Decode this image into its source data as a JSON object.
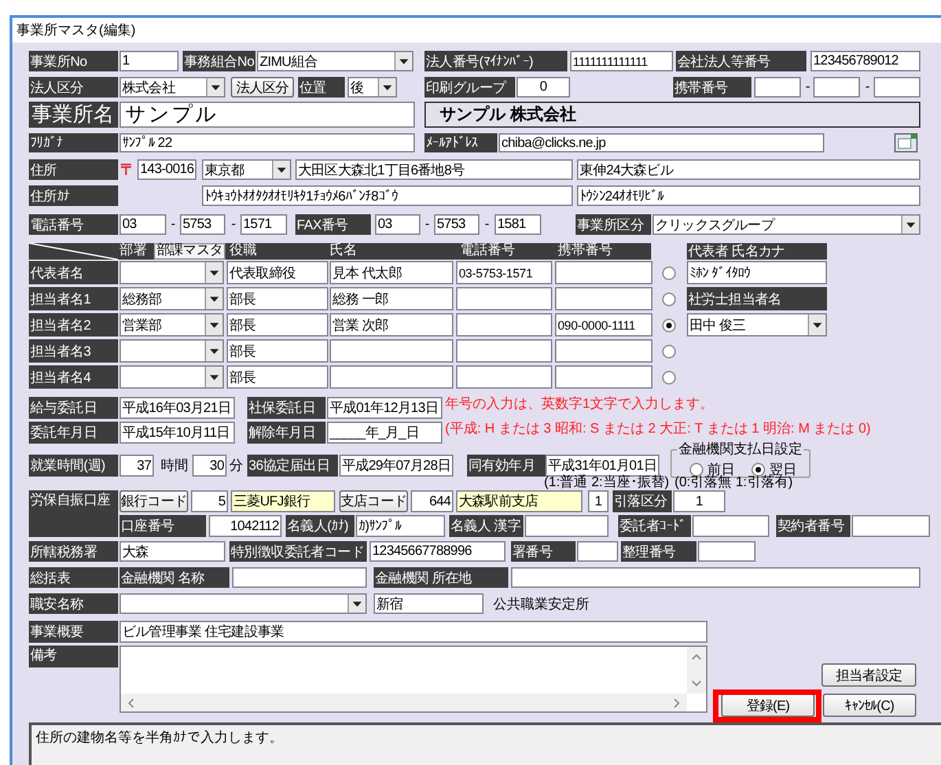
{
  "window": {
    "title": "事業所マスタ(編集)"
  },
  "header_rows": [
    {
      "items": [
        {
          "kind": "label",
          "text": "事業所No"
        },
        {
          "kind": "input",
          "value": "1"
        },
        {
          "kind": "label",
          "text": "事務組合No"
        },
        {
          "kind": "select",
          "value": "ZIMU組合"
        },
        {
          "kind": "label",
          "text": "法人番号(ﾏｲﾅﾝﾊﾞｰ)"
        },
        {
          "kind": "input",
          "value": "1111111111111"
        },
        {
          "kind": "label",
          "text": "会社法人等番号"
        },
        {
          "kind": "input",
          "value": "123456789012"
        }
      ]
    },
    {
      "items": [
        {
          "kind": "label",
          "text": "法人区分"
        },
        {
          "kind": "select",
          "value": "株式会社"
        },
        {
          "kind": "button",
          "label": "法人区分"
        },
        {
          "kind": "label",
          "text": "位置"
        },
        {
          "kind": "select",
          "value": "後"
        },
        {
          "kind": "label",
          "text": "印刷グループ"
        },
        {
          "kind": "input",
          "value": "0"
        },
        {
          "kind": "label",
          "text": "携帯番号"
        },
        {
          "kind": "input"
        },
        {
          "kind": "text",
          "text": "-"
        },
        {
          "kind": "input"
        },
        {
          "kind": "text",
          "text": "-"
        },
        {
          "kind": "input"
        }
      ]
    },
    {
      "items": [
        {
          "kind": "label-large",
          "text": "事業所名"
        },
        {
          "kind": "input-large",
          "value": "サンプル"
        },
        {
          "kind": "banner",
          "text": "サンプル 株式会社"
        }
      ]
    },
    {
      "items": [
        {
          "kind": "label",
          "text": "ﾌﾘｶﾞﾅ"
        },
        {
          "kind": "input",
          "value": "ｻﾝﾌﾟﾙ 22"
        },
        {
          "kind": "label",
          "text": "ﾒｰﾙｱﾄﾞﾚｽ"
        },
        {
          "kind": "input",
          "value": "chiba@clicks.ne.jp"
        },
        {
          "kind": "icon"
        }
      ]
    },
    {
      "items": [
        {
          "kind": "label",
          "text": "住所"
        },
        {
          "kind": "postal",
          "text": "〒"
        },
        {
          "kind": "input",
          "value": "143-0016"
        },
        {
          "kind": "select",
          "value": "東京都"
        },
        {
          "kind": "input",
          "value": "大田区大森北1丁目6番地8号"
        },
        {
          "kind": "input",
          "value": "東伸24大森ビル"
        }
      ]
    },
    {
      "items": [
        {
          "kind": "label",
          "text": "住所ｶﾅ"
        },
        {
          "kind": "input",
          "value": "ﾄｳｷｮｳﾄｵｵﾀｸｵｵﾓﾘｷﾀ1ﾁｮｳﾒ6ﾊﾞﾝﾁ8ｺﾞｳ"
        },
        {
          "kind": "input",
          "value": "ﾄｳｼﾝ24ｵｵﾓﾘﾋﾞﾙ"
        }
      ]
    },
    {
      "items": [
        {
          "kind": "label",
          "text": "電話番号"
        },
        {
          "kind": "input",
          "value": "03"
        },
        {
          "kind": "text",
          "text": "-"
        },
        {
          "kind": "input",
          "value": "5753"
        },
        {
          "kind": "text",
          "text": "-"
        },
        {
          "kind": "input",
          "value": "1571"
        },
        {
          "kind": "label",
          "text": "FAX番号"
        },
        {
          "kind": "input",
          "value": "03"
        },
        {
          "kind": "text",
          "text": "-"
        },
        {
          "kind": "input",
          "value": "5753"
        },
        {
          "kind": "text",
          "text": "-"
        },
        {
          "kind": "input",
          "value": "1581"
        },
        {
          "kind": "label",
          "text": "事業所区分"
        },
        {
          "kind": "select",
          "value": "クリックスグループ"
        }
      ]
    }
  ],
  "contacts": {
    "headers": [
      "部署",
      "役職",
      "氏名",
      "電話番号",
      "携帯番号"
    ],
    "master_button": "部課マスタ",
    "kana_label": "代表者 氏名カナ",
    "kana_value": "ﾐﾎﾝ ﾀﾞｲﾀﾛｳ",
    "consultant_label": "社労士担当者名",
    "consultant": "田中 俊三",
    "rows": [
      {
        "label": "代表者名",
        "title": "代表取締役",
        "name": "見本 代太郎",
        "phone": "03-5753-1571",
        "selected": false
      },
      {
        "label": "担当者名1",
        "department": "総務部",
        "title": "部長",
        "name": "総務 一郎",
        "selected": false
      },
      {
        "label": "担当者名2",
        "department": "営業部",
        "title": "部長",
        "name": "営業 次郎",
        "mobile": "090-0000-1111",
        "selected": true
      },
      {
        "label": "担当者名3",
        "title": "部長",
        "selected": false
      },
      {
        "label": "担当者名4",
        "title": "部長",
        "selected": false
      }
    ]
  },
  "date_rows": [
    {
      "items": [
        {
          "kind": "label",
          "text": "給与委託日"
        },
        {
          "kind": "input",
          "value": "平成16年03月21日"
        },
        {
          "kind": "label",
          "text": "社保委託日"
        },
        {
          "kind": "input",
          "value": "平成01年12月13日"
        },
        {
          "kind": "note",
          "text": "年号の入力は、英数字1文字で入力します。"
        }
      ]
    },
    {
      "items": [
        {
          "kind": "label",
          "text": "委託年月日"
        },
        {
          "kind": "input",
          "value": "平成15年10月11日"
        },
        {
          "kind": "label",
          "text": "解除年月日"
        },
        {
          "kind": "input",
          "value": "_____年_月_日"
        },
        {
          "kind": "note",
          "text": "(平成: H または 3  昭和: S または 2  大正: T または 1  明治: M または 0)"
        }
      ]
    },
    {
      "items": [
        {
          "kind": "label",
          "text": "就業時間(週)"
        },
        {
          "kind": "input",
          "value": "37"
        },
        {
          "kind": "text",
          "text": "時間"
        },
        {
          "kind": "input",
          "value": "30"
        },
        {
          "kind": "text",
          "text": "分"
        },
        {
          "kind": "label",
          "text": "36協定届出日"
        },
        {
          "kind": "input",
          "value": "平成29年07月28日"
        },
        {
          "kind": "label",
          "text": "同有効年月"
        },
        {
          "kind": "input",
          "value": "平成31年01月01日"
        },
        {
          "kind": "radio-group",
          "title": "金融機関支払日設定",
          "options": [
            {
              "label": "前日",
              "selected": false
            },
            {
              "label": "翌日",
              "selected": true
            }
          ]
        }
      ]
    },
    {
      "items": [
        {
          "kind": "text",
          "text": "(1:普通 2:当座･振替)"
        },
        {
          "kind": "text",
          "text": "(0:引落無 1:引落有)"
        }
      ]
    }
  ],
  "bank_account": {
    "label": "労保自振口座",
    "rows": [
      {
        "items": [
          {
            "kind": "button",
            "label": "銀行コード"
          },
          {
            "kind": "input",
            "value": "5"
          },
          {
            "kind": "lookup",
            "value": "三菱UFJ銀行"
          },
          {
            "kind": "button",
            "label": "支店コード"
          },
          {
            "kind": "input",
            "value": "644"
          },
          {
            "kind": "lookup",
            "value": "大森駅前支店"
          },
          {
            "kind": "input",
            "value": "1"
          },
          {
            "kind": "label",
            "text": "引落区分"
          },
          {
            "kind": "input",
            "value": "1"
          }
        ]
      },
      {
        "items": [
          {
            "kind": "label",
            "text": "口座番号"
          },
          {
            "kind": "input",
            "value": "1042112"
          },
          {
            "kind": "label",
            "text": "名義人(ｶﾅ)"
          },
          {
            "kind": "input",
            "value": "ｶ)ｻﾝﾌﾟﾙ"
          },
          {
            "kind": "label",
            "text": "名義人 漢字"
          },
          {
            "kind": "input"
          },
          {
            "kind": "label",
            "text": "委託者ｺｰﾄﾞ"
          },
          {
            "kind": "input"
          },
          {
            "kind": "label",
            "text": "契約者番号"
          },
          {
            "kind": "input"
          }
        ]
      }
    ]
  },
  "detail_rows": [
    {
      "items": [
        {
          "kind": "label",
          "text": "所轄税務署"
        },
        {
          "kind": "input",
          "value": "大森"
        },
        {
          "kind": "label",
          "text": "特別徴収委託者コード"
        },
        {
          "kind": "input",
          "value": "12345667788996"
        },
        {
          "kind": "label",
          "text": "署番号"
        },
        {
          "kind": "input"
        },
        {
          "kind": "label",
          "text": "整理番号"
        },
        {
          "kind": "input"
        }
      ]
    },
    {
      "items": [
        {
          "kind": "label",
          "text": "総括表"
        },
        {
          "kind": "label",
          "text": "金融機関  名称"
        },
        {
          "kind": "input"
        },
        {
          "kind": "label",
          "text": "金融機関  所在地"
        },
        {
          "kind": "input"
        }
      ]
    },
    {
      "items": [
        {
          "kind": "label",
          "text": "職安名称"
        },
        {
          "kind": "select"
        },
        {
          "kind": "input",
          "value": "新宿"
        },
        {
          "kind": "text",
          "text": "公共職業安定所"
        }
      ]
    },
    {
      "items": [
        {
          "kind": "label",
          "text": "事業概要"
        },
        {
          "kind": "input",
          "value": "ビル管理事業  住宅建設事業"
        }
      ]
    }
  ],
  "remarks": {
    "label": "備考"
  },
  "buttons": [
    {
      "label": "担当者設定",
      "highlighted": false
    },
    {
      "label": "登録(E)",
      "highlighted": true
    },
    {
      "label": "ｷｬﾝｾﾙ(C)",
      "highlighted": false
    }
  ],
  "status_bar": {
    "message": "住所の建物名等を半角ｶﾅで入力します。"
  }
}
